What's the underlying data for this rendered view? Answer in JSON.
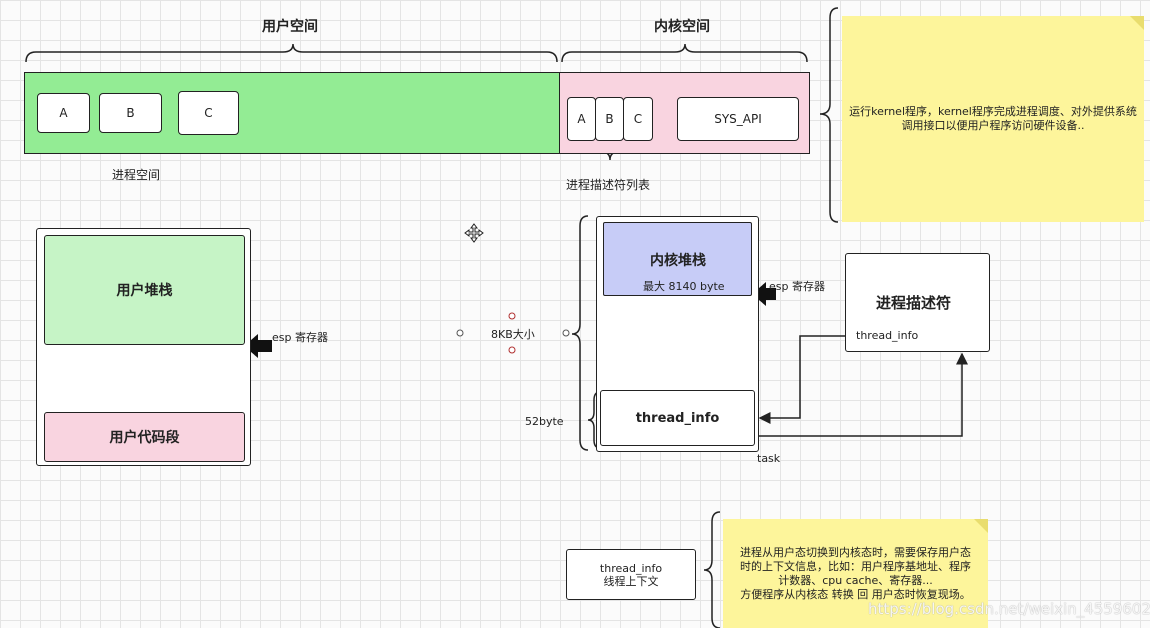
{
  "user_space": {
    "title": "用户空间",
    "process_space_label": "进程空间",
    "boxes": [
      "A",
      "B",
      "C"
    ]
  },
  "kernel_space": {
    "title": "内核空间",
    "descriptor_list_label": "进程描述符列表",
    "boxes": [
      "A",
      "B",
      "C"
    ],
    "sys_api": "SYS_API"
  },
  "note_top": "运行kernel程序，kernel程序完成进程调度、对外提供系统调用接口以便用户程序访问硬件设备..",
  "user_stack": {
    "title": "用户堆栈",
    "code_segment": "用户代码段",
    "esp_label": "esp 寄存器"
  },
  "size_label": "8KB大小",
  "kernel_stack": {
    "title": "内核堆栈",
    "max_label": "最大 8140 byte",
    "esp_label": "esp 寄存器"
  },
  "thread_info": {
    "label": "thread_info",
    "size_label": "52byte",
    "task_label": "task"
  },
  "descriptor": {
    "title": "进程描述符",
    "field": "thread_info"
  },
  "legend_box": {
    "line1": "thread_info",
    "line2": "线程上下文"
  },
  "note_bottom": {
    "lines": [
      "进程从用户态切换到内核态时，需要保存用户态",
      "时的上下文信息，比如：用户程序基地址、程序",
      "计数器、cpu cache、寄存器...",
      "方便程序从内核态 转换 回 用户态时恢复现场。"
    ]
  },
  "watermark": "https://blog.csdn.net/weixin_45596022",
  "colors": {
    "user_green": "#93ec94",
    "kernel_pink": "#f9d4e0",
    "stack_green": "#c6f4c6",
    "kernel_stack_blue": "#c7ccf7",
    "note_yellow": "#fdf59b"
  }
}
